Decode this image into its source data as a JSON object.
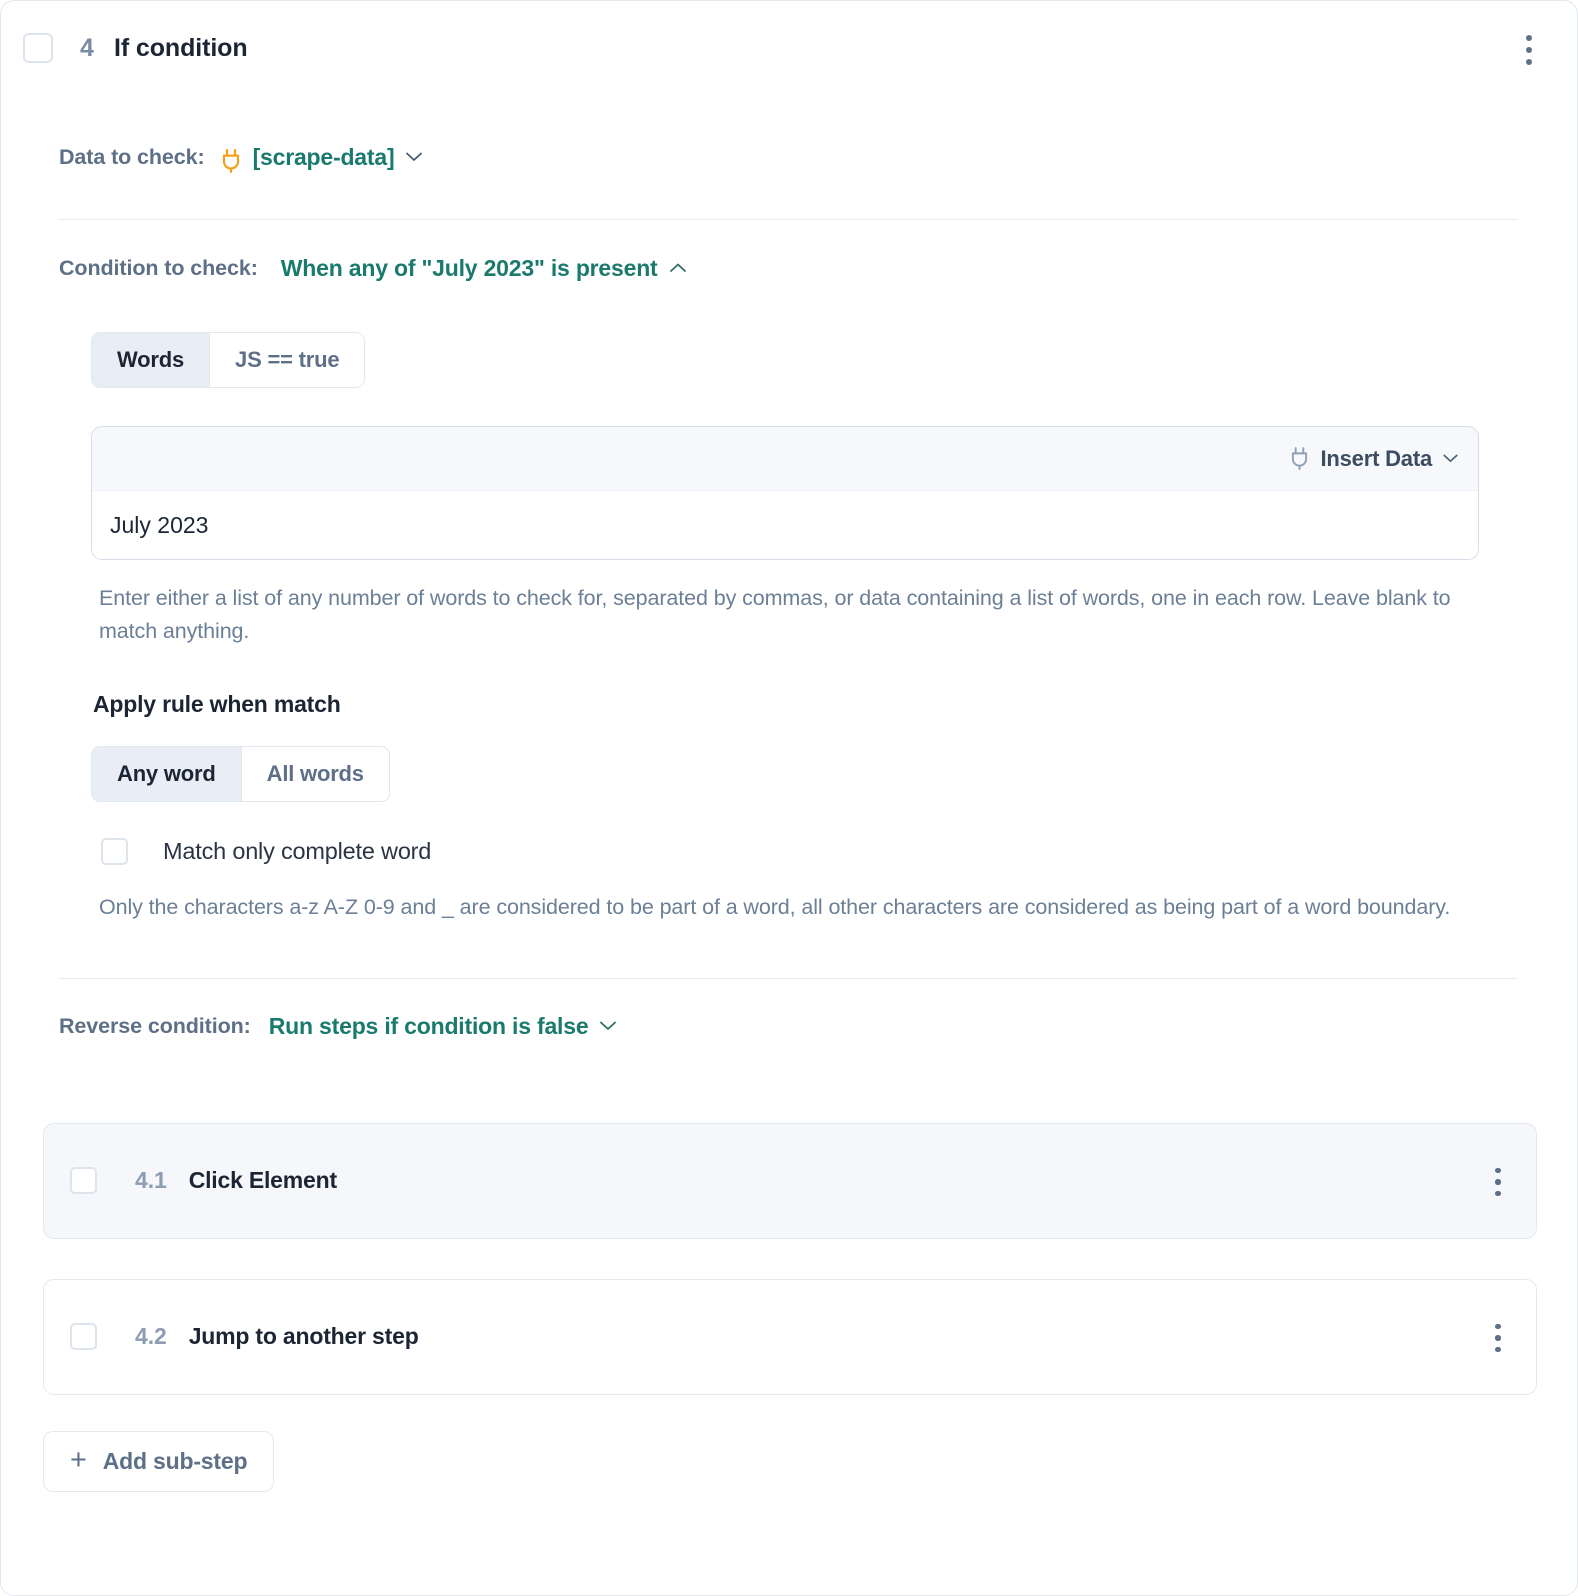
{
  "step": {
    "number": "4",
    "title": "If condition",
    "menu_icon": "kebab-menu-icon",
    "checkbox_checked": false
  },
  "data_to_check": {
    "label": "Data to check:",
    "value": "[scrape-data]",
    "icon": "plug-icon",
    "icon_color": "#F4A01E",
    "caret": "chevron-down-icon"
  },
  "condition_to_check": {
    "label": "Condition to check:",
    "value": "When any of \"July 2023\" is present",
    "caret": "chevron-up-icon",
    "expanded": true
  },
  "mode_toggle": {
    "options": [
      "Words",
      "JS == true"
    ],
    "selected": "Words"
  },
  "words_field": {
    "insert_data_label": "Insert Data",
    "insert_data_icon": "plug-icon",
    "insert_data_caret": "chevron-down-icon",
    "value": "July 2023",
    "placeholder": "",
    "help_text": "Enter either a list of any number of words to check for, separated by commas, or data containing a list of words, one in each row. Leave blank to match anything."
  },
  "apply_rule": {
    "heading": "Apply rule when match",
    "options": [
      "Any word",
      "All words"
    ],
    "selected": "Any word"
  },
  "match_complete_word": {
    "label": "Match only complete word",
    "checked": false,
    "help_text": "Only the characters a-z A-Z 0-9 and _ are considered to be part of a word, all other characters are considered as being part of a word boundary."
  },
  "reverse_condition": {
    "label": "Reverse condition:",
    "value": "Run steps if condition is false",
    "caret": "chevron-down-icon"
  },
  "substeps": [
    {
      "number": "4.1",
      "title": "Click Element",
      "shaded": true,
      "checked": false
    },
    {
      "number": "4.2",
      "title": "Jump to another step",
      "shaded": false,
      "checked": false
    }
  ],
  "add_substep": {
    "label": "Add sub-step",
    "icon": "plus-icon"
  },
  "colors": {
    "teal": "#1a7a6d",
    "label_gray": "#5d7087",
    "title_dark": "#1c2534",
    "border": "#e3e9ef",
    "shaded_bg": "#f5f7fa",
    "orange": "#F4A01E"
  }
}
